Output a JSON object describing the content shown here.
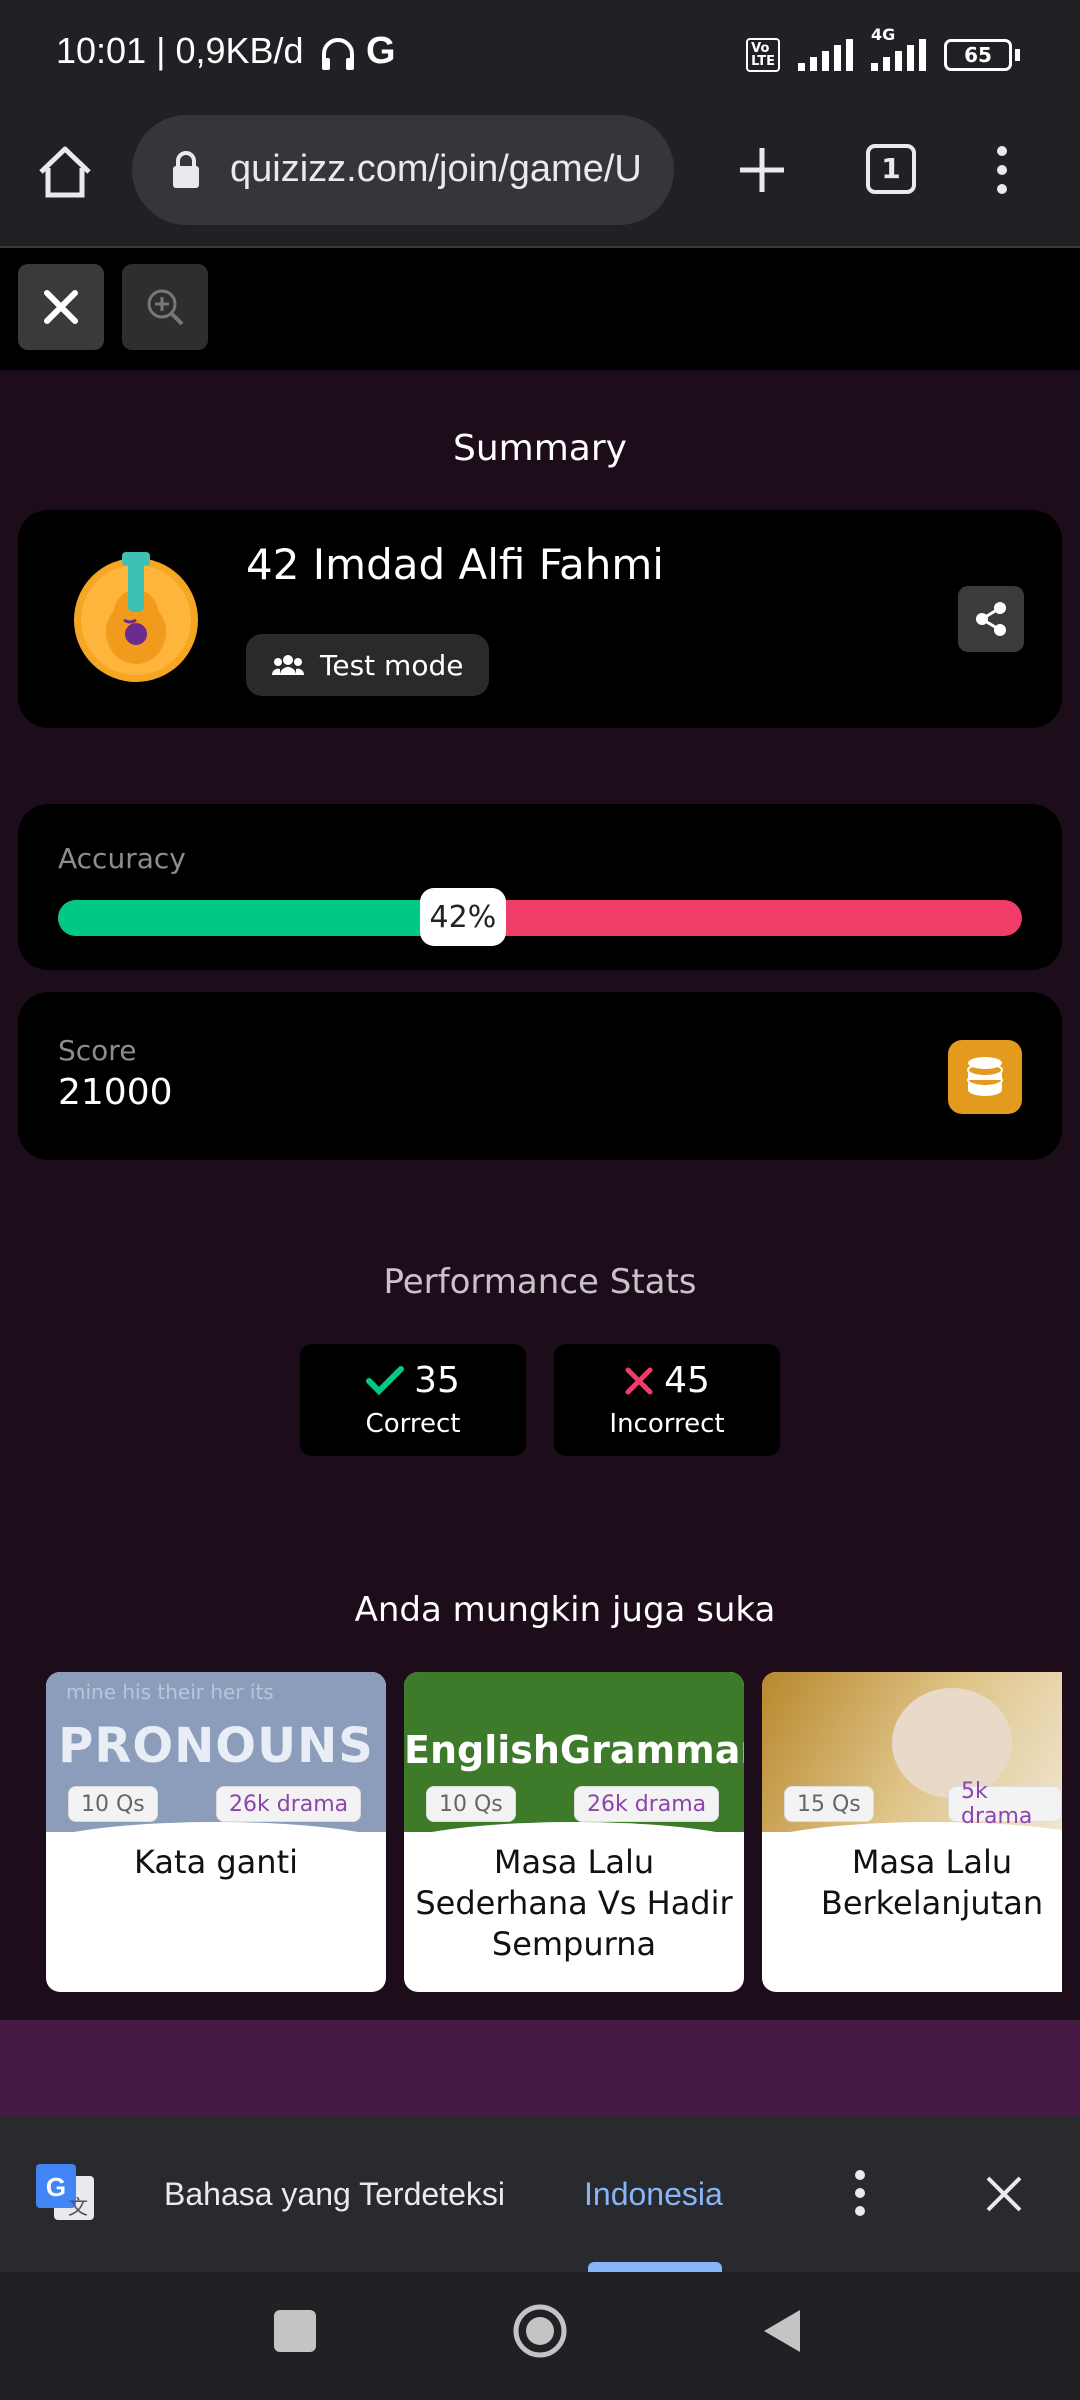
{
  "status_bar": {
    "time_and_speed": "10:01 | 0,9KB/d",
    "network": "4G",
    "battery": "65"
  },
  "browser": {
    "url": "quizizz.com/join/game/U",
    "tab_count": "1"
  },
  "summary": {
    "title": "Summary",
    "player_name": "42 Imdad Alfi Fahmi",
    "mode_label": "Test mode"
  },
  "accuracy": {
    "label": "Accuracy",
    "value_text": "42%",
    "fraction": 0.42
  },
  "score": {
    "label": "Score",
    "value": "21000"
  },
  "performance": {
    "title": "Performance Stats",
    "correct_count": "35",
    "correct_label": "Correct",
    "incorrect_count": "45",
    "incorrect_label": "Incorrect"
  },
  "recommendations": {
    "title": "Anda mungkin juga suka",
    "items": [
      {
        "image_text": "PRONOUNS",
        "questions": "10 Qs",
        "plays": "26k drama",
        "name": "Kata ganti"
      },
      {
        "image_text": "EnglishGrammar",
        "questions": "10 Qs",
        "plays": "26k drama",
        "name": "Masa Lalu Sederhana Vs Hadir Sempurna"
      },
      {
        "image_text": "",
        "questions": "15 Qs",
        "plays": "5k drama",
        "name": "Masa Lalu Berkelanjutan"
      }
    ]
  },
  "translate_bar": {
    "detected_label": "Bahasa yang Terdeteksi",
    "language": "Indonesia"
  },
  "colors": {
    "correct": "#00c985",
    "incorrect": "#ef3c69",
    "link": "#8ab4f8",
    "coin": "#e49a1d"
  }
}
